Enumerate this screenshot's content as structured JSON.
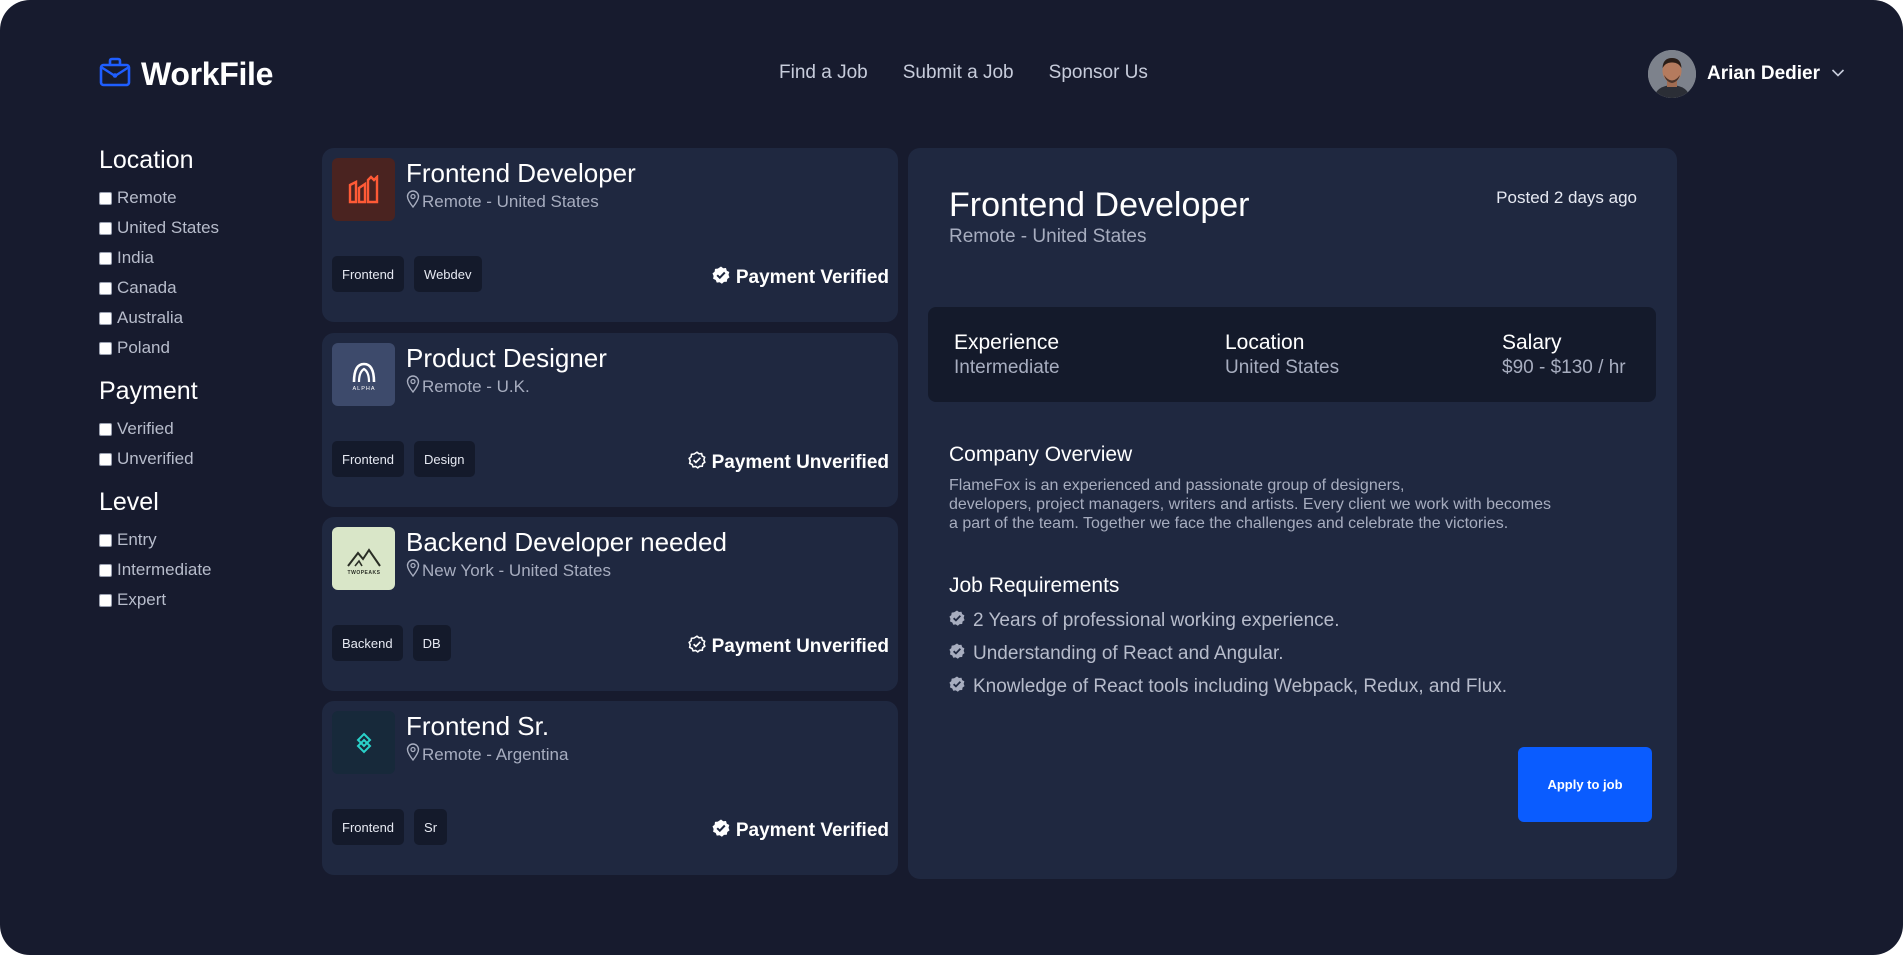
{
  "brand": {
    "name": "WorkFile",
    "accent": "#1f5eff"
  },
  "nav": [
    {
      "label": "Find a Job"
    },
    {
      "label": "Submit a Job"
    },
    {
      "label": "Sponsor Us"
    }
  ],
  "user": {
    "name": "Arian Dedier"
  },
  "filters": [
    {
      "title": "Location",
      "options": [
        "Remote",
        "United States",
        "India",
        "Canada",
        "Australia",
        "Poland"
      ]
    },
    {
      "title": "Payment",
      "options": [
        "Verified",
        "Unverified"
      ]
    },
    {
      "title": "Level",
      "options": [
        "Entry",
        "Intermediate",
        "Expert"
      ]
    }
  ],
  "jobs": [
    {
      "title": "Frontend Developer",
      "location": "Remote - United States",
      "tags": [
        "Frontend",
        "Webdev"
      ],
      "payment": "Payment Verified",
      "verified": true,
      "logo": "flamefox-logo",
      "logo_color": "#4a2320"
    },
    {
      "title": "Product Designer",
      "location": "Remote - U.K.",
      "tags": [
        "Frontend",
        "Design"
      ],
      "payment": "Payment Unverified",
      "verified": false,
      "logo": "alpha-logo",
      "logo_color": "#3d4a6b",
      "logo_text": "ALPHA"
    },
    {
      "title": "Backend Developer needed",
      "location": "New York - United States",
      "tags": [
        "Backend",
        "DB"
      ],
      "payment": "Payment Unverified",
      "verified": false,
      "logo": "twopeaks-logo",
      "logo_color": "#d9e6c8",
      "logo_text": "TWOPEAKS"
    },
    {
      "title": "Frontend Sr.",
      "location": "Remote - Argentina",
      "tags": [
        "Frontend",
        "Sr"
      ],
      "payment": "Payment Verified",
      "verified": true,
      "logo": "diamond-logo",
      "logo_color": "#17293a"
    }
  ],
  "detail": {
    "title": "Frontend Developer",
    "location": "Remote - United States",
    "posted": "Posted 2 days ago",
    "stats": [
      {
        "label": "Experience",
        "value": "Intermediate"
      },
      {
        "label": "Location",
        "value": "United States"
      },
      {
        "label": "Salary",
        "value": "$90 - $130 / hr"
      }
    ],
    "overview_title": "Company Overview",
    "overview_lines": [
      "FlameFox is an experienced and passionate group of designers,",
      "developers, project managers, writers and artists. Every client we work with becomes",
      "a part of the team. Together we face the challenges and celebrate the victories."
    ],
    "requirements_title": "Job Requirements",
    "requirements": [
      "2 Years of professional working experience.",
      "Understanding of React and Angular.",
      "Knowledge of React tools including Webpack, Redux, and Flux."
    ],
    "apply_label": "Apply to job"
  }
}
